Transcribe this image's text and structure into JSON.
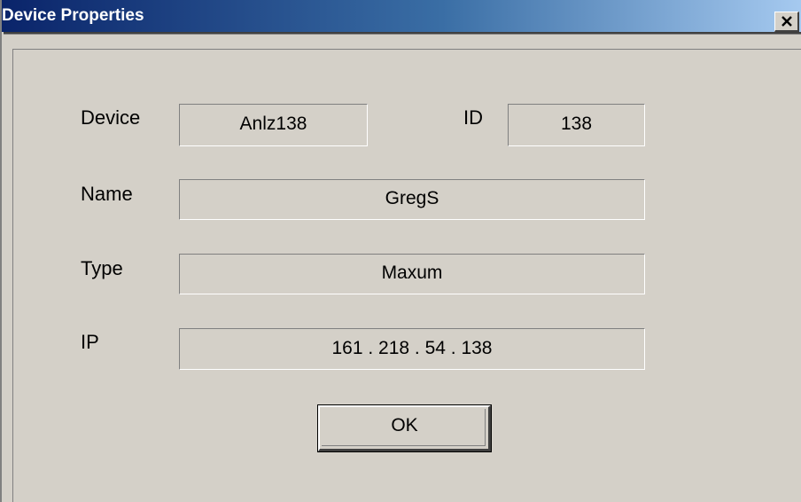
{
  "window": {
    "title": "Device Properties",
    "close_icon": "close-icon"
  },
  "form": {
    "device": {
      "label": "Device",
      "value": "Anlz138"
    },
    "id": {
      "label": "ID",
      "value": "138"
    },
    "name": {
      "label": "Name",
      "value": "GregS"
    },
    "type": {
      "label": "Type",
      "value": "Maxum"
    },
    "ip": {
      "label": "IP",
      "value": "161 . 218 . 54 . 138"
    }
  },
  "buttons": {
    "ok_label": "OK"
  }
}
